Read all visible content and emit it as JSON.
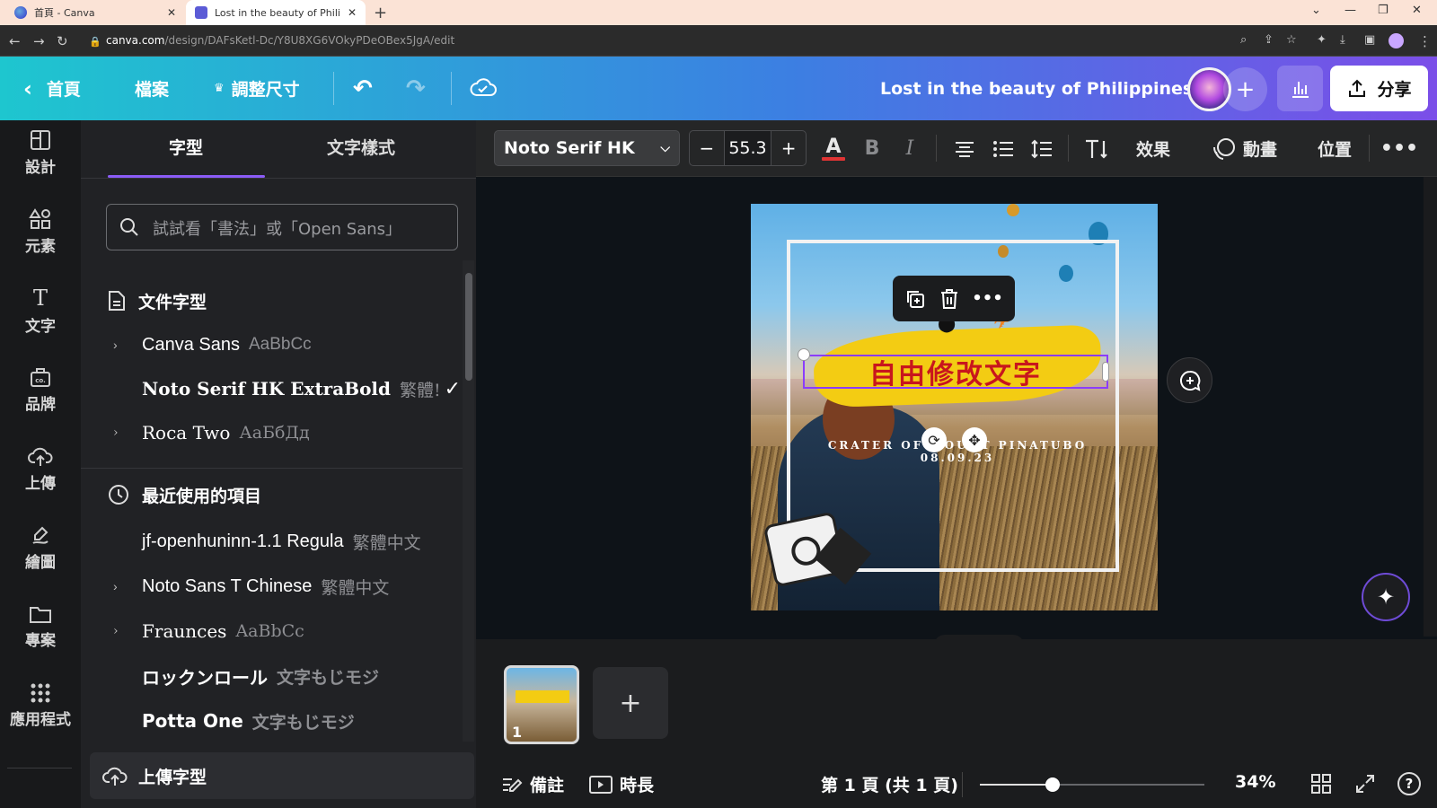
{
  "browser": {
    "tabs": [
      {
        "title": "首頁 - Canva",
        "active": false
      },
      {
        "title": "Lost in the beauty of Philippine",
        "active": true
      }
    ],
    "url_host": "canva.com",
    "url_path": "/design/DAFsKetl-Dc/Y8U8XG6VOkyPDeOBex5JgA/edit"
  },
  "header": {
    "home": "首頁",
    "file": "檔案",
    "resize": "調整尺寸",
    "design_title": "Lost in the beauty of Philippines",
    "share": "分享"
  },
  "rail": [
    "設計",
    "元素",
    "文字",
    "品牌",
    "上傳",
    "繪圖",
    "專案",
    "應用程式"
  ],
  "panel": {
    "tab_fonts": "字型",
    "tab_styles": "文字樣式",
    "search_placeholder": "試試看「書法」或「Open Sans」",
    "document_fonts_heading": "文件字型",
    "document_fonts": [
      {
        "name": "Canva Sans",
        "sample": "AaBbCc",
        "expandable": true,
        "selected": false
      },
      {
        "name": "Noto Serif HK ExtraBold",
        "sample": "繁體!",
        "expandable": false,
        "selected": true
      },
      {
        "name": "Roca Two",
        "sample": "АаБбДд",
        "expandable": true,
        "selected": false
      }
    ],
    "recent_heading": "最近使用的項目",
    "recent_fonts": [
      {
        "name": "jf-openhuninn-1.1 Regula",
        "sample": "繁體中文",
        "expandable": false
      },
      {
        "name": "Noto Sans T Chinese",
        "sample": "繁體中文",
        "expandable": true
      },
      {
        "name": "Fraunces",
        "sample": "AaBbCc",
        "expandable": true
      },
      {
        "name": "ロックンロール",
        "sample": "文字もじモジ",
        "expandable": false
      },
      {
        "name": "Potta One",
        "sample": "文字もじモジ",
        "expandable": false
      }
    ],
    "upload_font": "上傳字型"
  },
  "toolbar": {
    "font_family": "Noto Serif HK",
    "font_size": "55.3",
    "minus": "−",
    "plus": "+",
    "text_color_letter": "A",
    "bold_letter": "B",
    "italic_letter": "I",
    "effects": "效果",
    "animate": "動畫",
    "position": "位置",
    "text_color": "#e03434"
  },
  "design": {
    "headline": "自由修改文字",
    "subtitle_line1": "CRATER OF MOUNT PINATUBO",
    "subtitle_line2": "08.09.23"
  },
  "footer": {
    "notes": "備註",
    "duration": "時長",
    "page_indicator": "第 1 頁 (共 1 頁)",
    "zoom": "34%",
    "zoom_level": 0.34,
    "page_number": "1"
  }
}
